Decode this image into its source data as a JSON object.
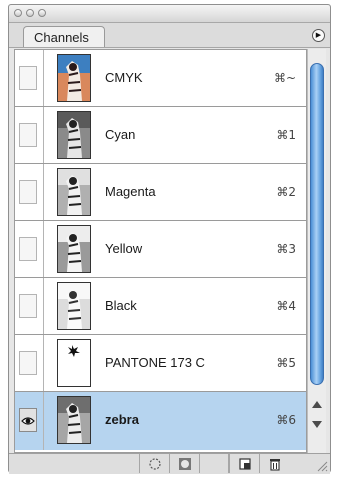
{
  "window": {
    "panel_tab": "Channels",
    "menu_icon": "triangle-right",
    "accent_color": "#b6d4ef",
    "scroll_color": "#6aa6e2"
  },
  "channels": [
    {
      "name": "CMYK",
      "shortcut": "⌘~",
      "visible": false,
      "selected": false
    },
    {
      "name": "Cyan",
      "shortcut": "⌘1",
      "visible": false,
      "selected": false
    },
    {
      "name": "Magenta",
      "shortcut": "⌘2",
      "visible": false,
      "selected": false
    },
    {
      "name": "Yellow",
      "shortcut": "⌘3",
      "visible": false,
      "selected": false
    },
    {
      "name": "Black",
      "shortcut": "⌘4",
      "visible": false,
      "selected": false
    },
    {
      "name": "PANTONE 173 C",
      "shortcut": "⌘5",
      "visible": false,
      "selected": false
    },
    {
      "name": "zebra",
      "shortcut": "⌘6",
      "visible": true,
      "selected": true
    }
  ],
  "bottom_buttons": [
    "load-selection-icon",
    "save-selection-icon",
    "new-channel-icon",
    "trash-icon"
  ]
}
